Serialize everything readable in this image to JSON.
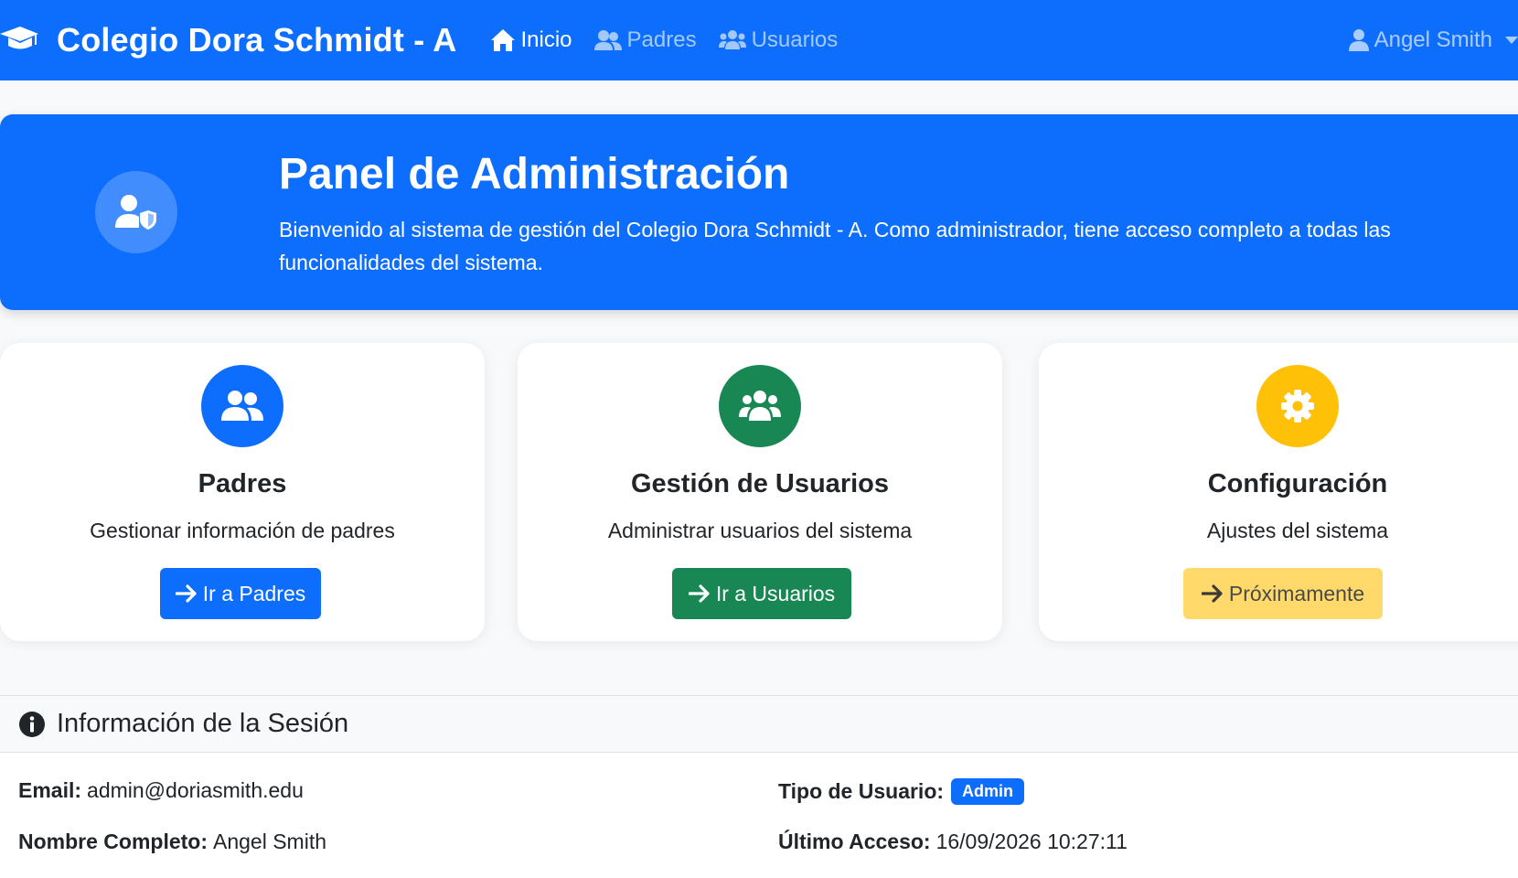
{
  "navbar": {
    "brand": "Colegio Dora Schmidt - A",
    "links": [
      {
        "label": "Inicio",
        "icon": "home-icon",
        "active": true
      },
      {
        "label": "Padres",
        "icon": "parents-icon",
        "active": false
      },
      {
        "label": "Usuarios",
        "icon": "users-icon",
        "active": false
      }
    ],
    "user": "Angel Smith"
  },
  "hero": {
    "title": "Panel de Administración",
    "text": "Bienvenido al sistema de gestión del Colegio Dora Schmidt - A. Como administrador, tiene acceso completo a todas las funcionalidades del sistema.",
    "icon": "user-shield-icon"
  },
  "cards": [
    {
      "title": "Padres",
      "description": "Gestionar información de padres",
      "button": "Ir a Padres",
      "color": "#0d6efd",
      "icon": "user-friends-icon"
    },
    {
      "title": "Gestión de Usuarios",
      "description": "Administrar usuarios del sistema",
      "button": "Ir a Usuarios",
      "color": "#198754",
      "icon": "users-icon"
    },
    {
      "title": "Configuración",
      "description": "Ajustes del sistema",
      "button": "Próximamente",
      "color": "#ffc107",
      "icon": "cog-icon"
    }
  ],
  "session": {
    "title": "Información de la Sesión",
    "email_label": "Email:",
    "email": "admin@doriasmith.edu",
    "user_type_label": "Tipo de Usuario:",
    "user_type": "Admin",
    "name_label": "Nombre Completo:",
    "name": "Angel Smith",
    "last_access_label": "Último Acceso:",
    "last_access": "16/09/2026 10:27:11"
  },
  "colors": {
    "primary": "#0d6efd",
    "success": "#198754",
    "warning": "#ffc107"
  }
}
